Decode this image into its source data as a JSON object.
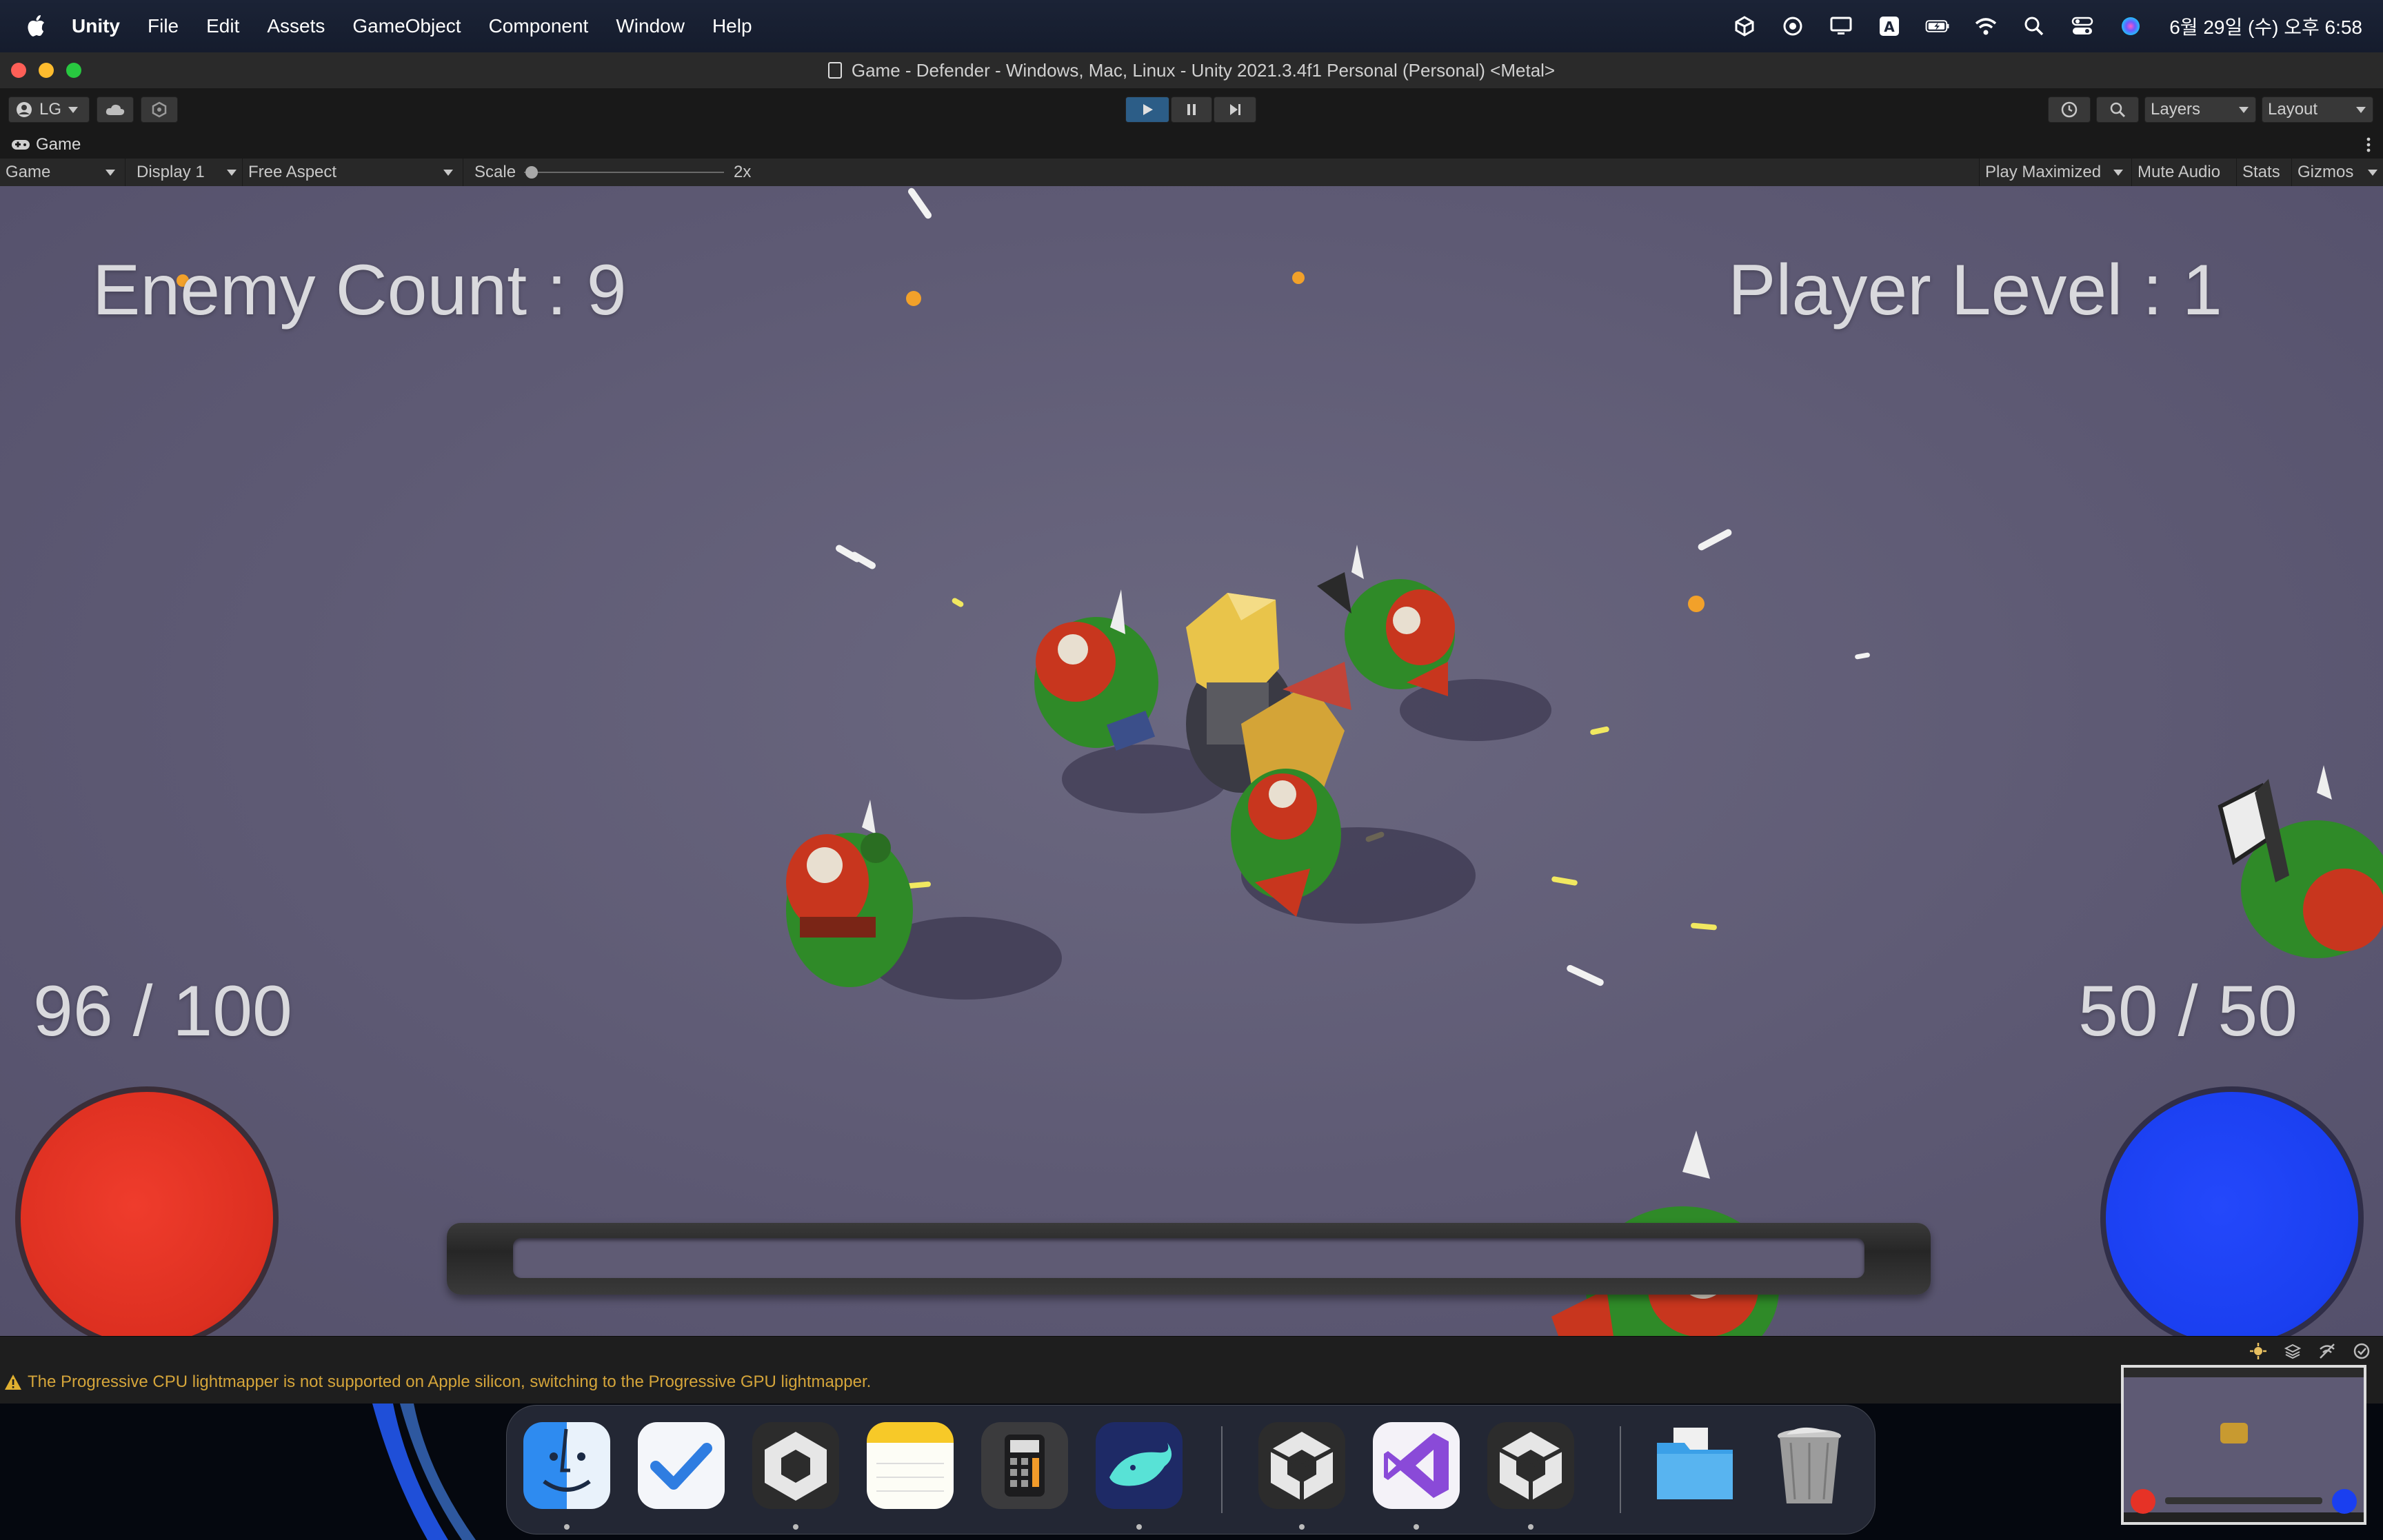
{
  "menubar": {
    "app": "Unity",
    "items": [
      "File",
      "Edit",
      "Assets",
      "GameObject",
      "Component",
      "Window",
      "Help"
    ],
    "clock": "6월 29일 (수) 오후 6:58"
  },
  "window": {
    "title": "Game - Defender - Windows, Mac, Linux - Unity 2021.3.4f1 Personal (Personal) <Metal>"
  },
  "toolbar": {
    "account": "LG",
    "layers": "Layers",
    "layout": "Layout"
  },
  "tab": {
    "label": "Game"
  },
  "gamebar": {
    "view": "Game",
    "display": "Display 1",
    "aspect": "Free Aspect",
    "scale_label": "Scale",
    "scale_value": "2x",
    "play_maximized": "Play Maximized",
    "mute_audio": "Mute Audio",
    "stats": "Stats",
    "gizmos": "Gizmos"
  },
  "hud": {
    "enemy_count": "Enemy Count : 9",
    "player_level": "Player Level : 1",
    "health": "96 / 100",
    "mana": "50 / 50",
    "colors": {
      "health_orb": "#e63226",
      "mana_orb": "#1a3ff0"
    }
  },
  "console": {
    "message": "The Progressive CPU lightmapper is not supported on Apple silicon, switching to the Progressive GPU lightmapper."
  },
  "dock": {
    "apps": [
      "finder-icon",
      "tasks-icon",
      "unity-hub-icon",
      "notes-icon",
      "calculator-icon",
      "whale-browser-icon",
      "unity-icon",
      "visual-studio-icon",
      "unity-icon",
      "folder-icon",
      "trash-icon"
    ]
  }
}
